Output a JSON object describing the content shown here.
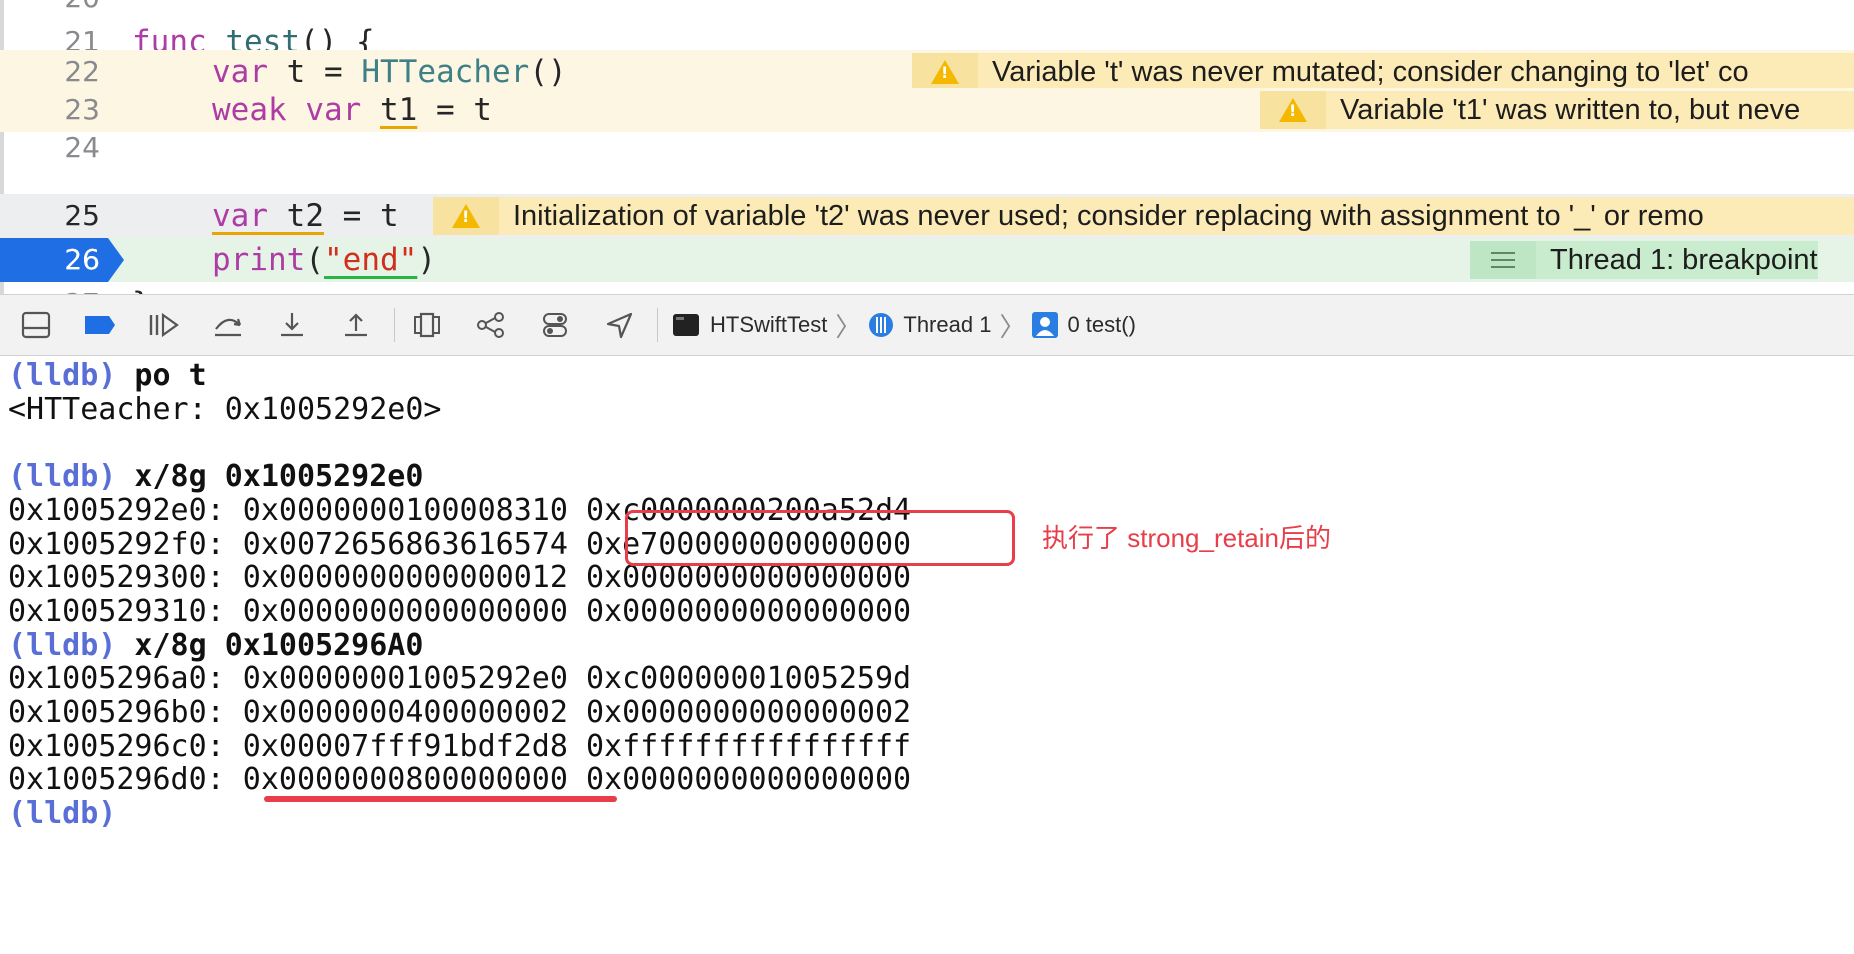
{
  "editor": {
    "lines": [
      {
        "num": "21",
        "code_parts": [
          [
            "kw",
            "func "
          ],
          [
            "fn",
            "test"
          ],
          [
            "pl",
            "() {"
          ]
        ]
      },
      {
        "num": "22",
        "code_parts": [
          [
            "kwu",
            "var"
          ],
          [
            "pl",
            " "
          ],
          [
            "plu",
            "t"
          ],
          [
            "pl",
            " = "
          ],
          [
            "ty",
            "HTTeacher"
          ],
          [
            "pl",
            "()"
          ]
        ]
      },
      {
        "num": "23",
        "code_parts": [
          [
            "kw",
            "weak var "
          ],
          [
            "plu",
            "t1"
          ],
          [
            "pl",
            " = t"
          ]
        ]
      },
      {
        "num": "24",
        "code_parts": []
      },
      {
        "num": "25",
        "code_parts": [
          [
            "kwu",
            "var"
          ],
          [
            "plu",
            " t2"
          ],
          [
            "pl",
            " = t"
          ]
        ]
      },
      {
        "num": "26",
        "code_parts": [
          [
            "kw",
            "print"
          ],
          [
            "pl",
            "("
          ],
          [
            "strg",
            "\"end\""
          ],
          [
            "pl",
            ")"
          ]
        ]
      }
    ],
    "partial_top_num": "20",
    "partial_bottom_num": "27",
    "partial_bottom_code": "}",
    "issues": [
      {
        "line": "22",
        "text": "Variable 't' was never mutated; consider changing to 'let' co"
      },
      {
        "line": "23",
        "text": "Variable 't1' was written to, but neve"
      },
      {
        "line": "25",
        "text": "Initialization of variable 't2' was never used; consider replacing with assignment to '_' or remo"
      }
    ],
    "breakpoint_label": "Thread 1: breakpoint"
  },
  "debugbar": {
    "buttons": [
      "hide-debug-area-icon",
      "breakpoints-toggle-icon",
      "continue-icon",
      "step-over-icon",
      "step-into-icon",
      "step-out-icon",
      "view-hierarchy-icon",
      "memory-graph-icon",
      "environment-overrides-icon",
      "simulate-location-icon"
    ],
    "crumbs": {
      "process": "HTSwiftTest",
      "thread": "Thread 1",
      "frame": "0 test()"
    }
  },
  "console": {
    "prefix": "(lldb)",
    "lines": [
      {
        "type": "cmd",
        "text": " po t"
      },
      {
        "type": "out",
        "text": "<HTTeacher: 0x1005292e0>"
      },
      {
        "type": "out",
        "text": ""
      },
      {
        "type": "cmd",
        "text": " x/8g 0x1005292e0"
      },
      {
        "type": "out",
        "text": "0x1005292e0: 0x0000000100008310 0xc0000000200a52d4"
      },
      {
        "type": "out",
        "text": "0x1005292f0: 0x0072656863616574 0xe700000000000000"
      },
      {
        "type": "out",
        "text": "0x100529300: 0x0000000000000012 0x0000000000000000"
      },
      {
        "type": "out",
        "text": "0x100529310: 0x0000000000000000 0x0000000000000000"
      },
      {
        "type": "cmd",
        "text": " x/8g 0x1005296A0"
      },
      {
        "type": "out",
        "text": "0x1005296a0: 0x00000001005292e0 0xc00000001005259d"
      },
      {
        "type": "out",
        "text": "0x1005296b0: 0x0000000400000002 0x0000000000000002"
      },
      {
        "type": "out",
        "text": "0x1005296c0: 0x00007fff91bdf2d8 0xffffffffffffffff"
      },
      {
        "type": "out",
        "text": "0x1005296d0: 0x0000000800000000 0x0000000000000000"
      },
      {
        "type": "cmd",
        "text": ""
      }
    ],
    "annotation": "执行了 strong_retain后的"
  },
  "colors": {
    "annotation": "#e83e4a",
    "warning": "#f5b800",
    "breakpoint": "#1f6ee3"
  }
}
